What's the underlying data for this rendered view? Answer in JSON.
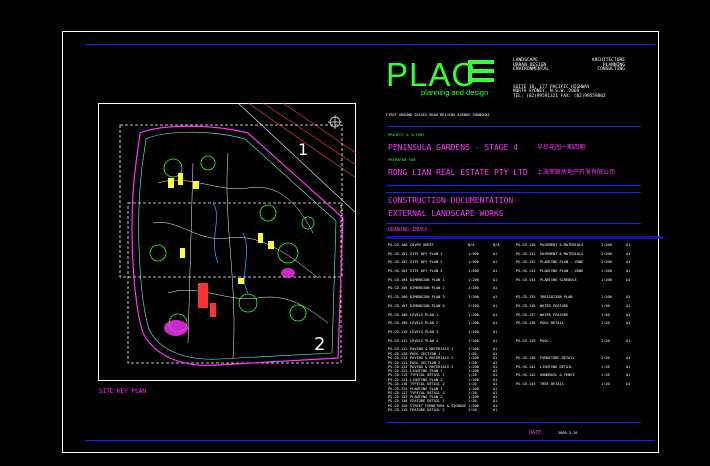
{
  "brand": {
    "logo_text": "PLAC",
    "tagline": "planning and design",
    "services_left": [
      "LANDSCAPE",
      "URBAN DESIGN",
      "ENVIRONMENTAL"
    ],
    "services_right": [
      "ARCHITECTURE",
      "PLANNING",
      "CONSULTING"
    ],
    "address_line1": "SUITE 10,      177 PACIFIC HIGHWAY",
    "address_line2": "NORTH SYDNEY, N.S.W.             2060",
    "address_line3": "TEL: (02)99591321           FAX: (02)99559802",
    "small_line": "FIRST GROUND SUSSEX ROAD BEIJING AVENUE SHANGHAI"
  },
  "project": {
    "label": "PROJECT & CLIENT",
    "name": "PENINSULA GARDENS - STAGE 4",
    "name_cn": "半岛花园一期四期",
    "prepared_label": "PREPARED FOR",
    "client": "RONG LIAN REAL ESTATE PTY LTD",
    "client_cn": "上海荣联房地产开发有限公司",
    "doc_line1": "CONSTRUCTION DOCUMENTATION",
    "doc_line2": "EXTERNAL LANDSCAPE WORKS"
  },
  "drawing_index": {
    "title": "DRAWING INDEX",
    "rows_left": [
      [
        "PG-CD-100",
        "COVER SHEET",
        "N/A",
        "",
        "N/A"
      ],
      [
        "PG-CD-101",
        "SITE KEY PLAN 1",
        "1:500",
        "",
        "A1"
      ],
      [
        "PG-CD-102",
        "SITE KEY PLAN 2",
        "1:500",
        "",
        "A1"
      ],
      [
        "PG-CD-103",
        "SITE KEY PLAN 3",
        "1:500",
        "",
        "A1"
      ],
      [
        "PG-CD-104",
        "DIMENSION PLAN 1",
        "1:200",
        "",
        "A1"
      ],
      [
        "PG-CD-105",
        "DIMENSION PLAN 2",
        "1:200",
        "",
        "A1"
      ],
      [
        "PG-CD-106",
        "DIMENSION PLAN 3",
        "1:200",
        "",
        "A1"
      ],
      [
        "PG-CD-107",
        "DIMENSION PLAN 4",
        "1:200",
        "",
        "A1"
      ],
      [
        "PG-CD-108",
        "LEVELS PLAN 1",
        "1:200",
        "",
        "A1"
      ],
      [
        "PG-CD-109",
        "LEVELS PLAN 2",
        "1:200",
        "",
        "A1"
      ],
      [
        "PG-CD-110",
        "LEVELS PLAN 3",
        "1:200",
        "",
        "A1"
      ],
      [
        "PG-CD-111",
        "LEVELS PLAN 4",
        "1:200",
        "",
        "A1"
      ],
      [
        "PG-CD-112",
        "PAVING & MATERIALS 1",
        "1:200",
        "",
        "A1"
      ],
      [
        "PG-CD-113",
        "PAVING & MATERIALS 2",
        "1:200",
        "",
        "A1"
      ],
      [
        "PG-CD-114",
        "PAVING & MATERIALS 3",
        "1:200",
        "",
        "A1"
      ],
      [
        "PG-CD-115",
        "TYPICAL DETAIL 1",
        "1:20",
        "",
        "A1"
      ],
      [
        "PG-CD-116",
        "TYPICAL DETAIL 2",
        "1:20",
        "",
        "A1"
      ],
      [
        "PG-CD-117",
        "TYPICAL DETAIL 3",
        "1:20",
        "",
        "A1"
      ],
      [
        "PG-CD-118",
        "FEATURE DETAIL 1",
        "1:20",
        "",
        "A1"
      ],
      [
        "PG-CD-119",
        "FEATURE DETAIL 2",
        "1:20",
        "",
        "A1"
      ]
    ],
    "rows_left_b": [
      [
        "PG-CD-120",
        "POOL SECTION 1",
        "1:50",
        "",
        "A1"
      ],
      [
        "PG-CD-121",
        "POOL SECTION 2",
        "1:50",
        "",
        "A1"
      ],
      [
        "PG-CD-122",
        "LIGHTING PLAN 1",
        "1:200",
        "",
        "A1"
      ],
      [
        "PG-CD-123",
        "LIGHTING PLAN 2",
        "1:200",
        "",
        "A1"
      ],
      [
        "PG-CD-124",
        "PLANTING PLAN 1",
        "1:200",
        "",
        "A1"
      ],
      [
        "PG-CD-125",
        "PLANTING PLAN 2",
        "1:200",
        "",
        "A1"
      ],
      [
        "PG-CD-126",
        "STREET FURNITURE & SIGNAGE",
        "1:200",
        "",
        "A1"
      ]
    ],
    "rows_right": [
      [
        "PG-CD-130",
        "PAVEMENT & MATERIALS",
        "1:200",
        "A1"
      ],
      [
        "PG-CD-131",
        "PAVEMENT & MATERIALS",
        "1:200",
        "A1"
      ],
      [
        "PG-CD-132",
        "PLANTING PLAN - ZONE",
        "1:200",
        "A1"
      ],
      [
        "PG-CD-133",
        "PLANTING PLAN - ZONE",
        "1:200",
        "A1"
      ],
      [
        "PG-CD-134",
        "PLANTING SCHEDULE",
        "1:200",
        "A1"
      ],
      [
        "",
        "",
        " ",
        ""
      ],
      [
        "PG-CD-135",
        "IRRIGATION PLAN",
        "1:200",
        "A1"
      ],
      [
        "PG-CD-136",
        "WATER FEATURE",
        "1:50",
        "A1"
      ],
      [
        "PG-CD-137",
        "WATER FEATURE",
        "1:50",
        "A1"
      ],
      [
        "PG-CD-138",
        "POOL DETAIL",
        "1:20",
        "A1"
      ],
      [
        "",
        "",
        " ",
        ""
      ],
      [
        "PG-CD-139",
        "POOL",
        "1:20",
        "A1"
      ],
      [
        "",
        "",
        " ",
        ""
      ],
      [
        "PG-CD-140",
        "FURNITURE DETAIL",
        "1:20",
        "A1"
      ],
      [
        "PG-CD-141",
        "LIGHTING DETAIL",
        "1:20",
        "A1"
      ],
      [
        "PG-CD-142",
        "HANDRAIL & FENCE",
        "1:20",
        "A1"
      ],
      [
        "PG-CD-143",
        "TREE DETAIL",
        "1:20",
        "A1"
      ]
    ]
  },
  "key_plan": {
    "label": "SITE KEY PLAN",
    "zone1": "1",
    "zone2": "2"
  },
  "footer": {
    "date_label": "DATE",
    "date_value": "2009.3.10"
  },
  "colors": {
    "background": "#000000",
    "border": "#ffffff",
    "rule": "#1a1aff",
    "text_magenta": "#ff33ff",
    "text_green": "#33ff33",
    "logo_green": "#33ff33"
  }
}
